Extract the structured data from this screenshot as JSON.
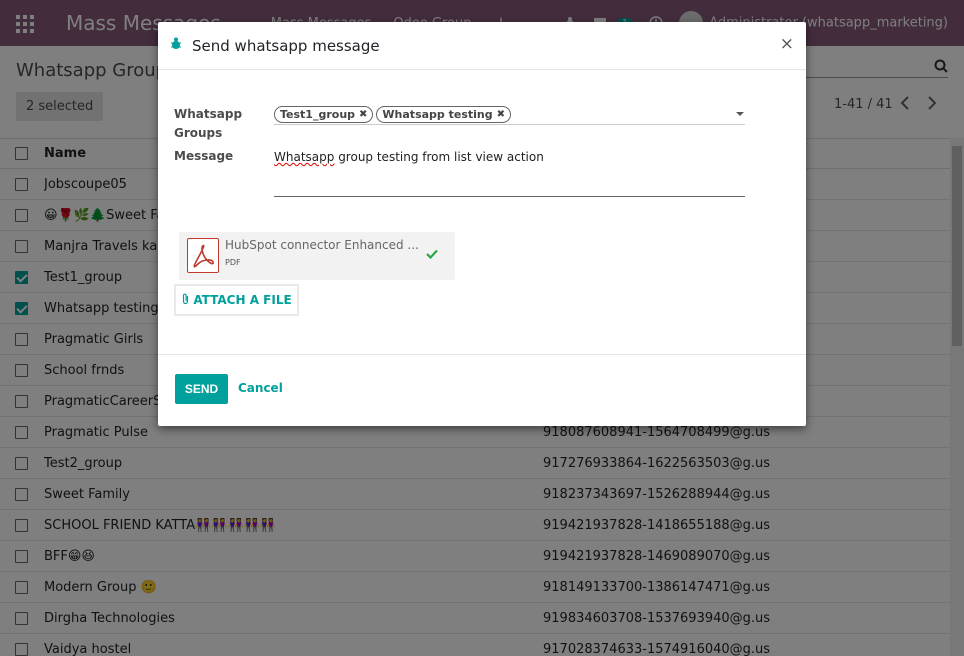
{
  "navbar": {
    "brand": "Mass Messages",
    "menu_1": "Mass Messages",
    "menu_2": "Odoo Group",
    "plus": "+",
    "chat_count": "1",
    "user": "Administrator (whatsapp_marketing)"
  },
  "control_panel": {
    "title": "Whatsapp Group",
    "selected": "2 selected",
    "pager": "1-41 / 41",
    "prev": "‹",
    "next": "›"
  },
  "list": {
    "header_name": "Name",
    "rows": [
      {
        "name": "Jobscoupe05",
        "jid": "",
        "checked": false
      },
      {
        "name": "😀🌹🌿🌲Sweet Fa",
        "jid": "",
        "checked": false
      },
      {
        "name": "Manjra Travels kalam",
        "jid": "",
        "checked": false
      },
      {
        "name": "Test1_group",
        "jid": "",
        "checked": true
      },
      {
        "name": "Whatsapp testing",
        "jid": "",
        "checked": true
      },
      {
        "name": "Pragmatic Girls",
        "jid": "",
        "checked": false
      },
      {
        "name": "School frnds",
        "jid": "",
        "checked": false
      },
      {
        "name": "PragmaticCareerSol",
        "jid": "",
        "checked": false
      },
      {
        "name": "Pragmatic Pulse",
        "jid": "918087608941-1564708499@g.us",
        "checked": false
      },
      {
        "name": "Test2_group",
        "jid": "917276933864-1622563503@g.us",
        "checked": false
      },
      {
        "name": "Sweet Family",
        "jid": "918237343697-1526288944@g.us",
        "checked": false
      },
      {
        "name": "SCHOOL FRIEND KATTA👭👭👭👭👭",
        "jid": "919421937828-1418655188@g.us",
        "checked": false
      },
      {
        "name": "BFF😁😆",
        "jid": "919421937828-1469089070@g.us",
        "checked": false
      },
      {
        "name": "Modern Group 🙂",
        "jid": "918149133700-1386147471@g.us",
        "checked": false
      },
      {
        "name": "Dirgha Technologies",
        "jid": "919834603708-1537693940@g.us",
        "checked": false
      },
      {
        "name": "Vaidya hostel",
        "jid": "917028374633-1574916040@g.us",
        "checked": false
      }
    ]
  },
  "modal": {
    "title": "Send whatsapp message",
    "close": "×",
    "groups_label": "Whatsapp Groups",
    "tags": [
      "Test1_group",
      "Whatsapp testing"
    ],
    "message_label": "Message",
    "message_word1": "Whatsapp",
    "message_rest": " group testing from list view action",
    "attachment_name": "HubSpot connector Enhanced ...",
    "attachment_type": "PDF",
    "attach_label": "ATTACH A FILE",
    "send_label": "SEND",
    "cancel_label": "Cancel"
  },
  "colors": {
    "navbar": "#875a7b",
    "accent": "#00a09d"
  }
}
